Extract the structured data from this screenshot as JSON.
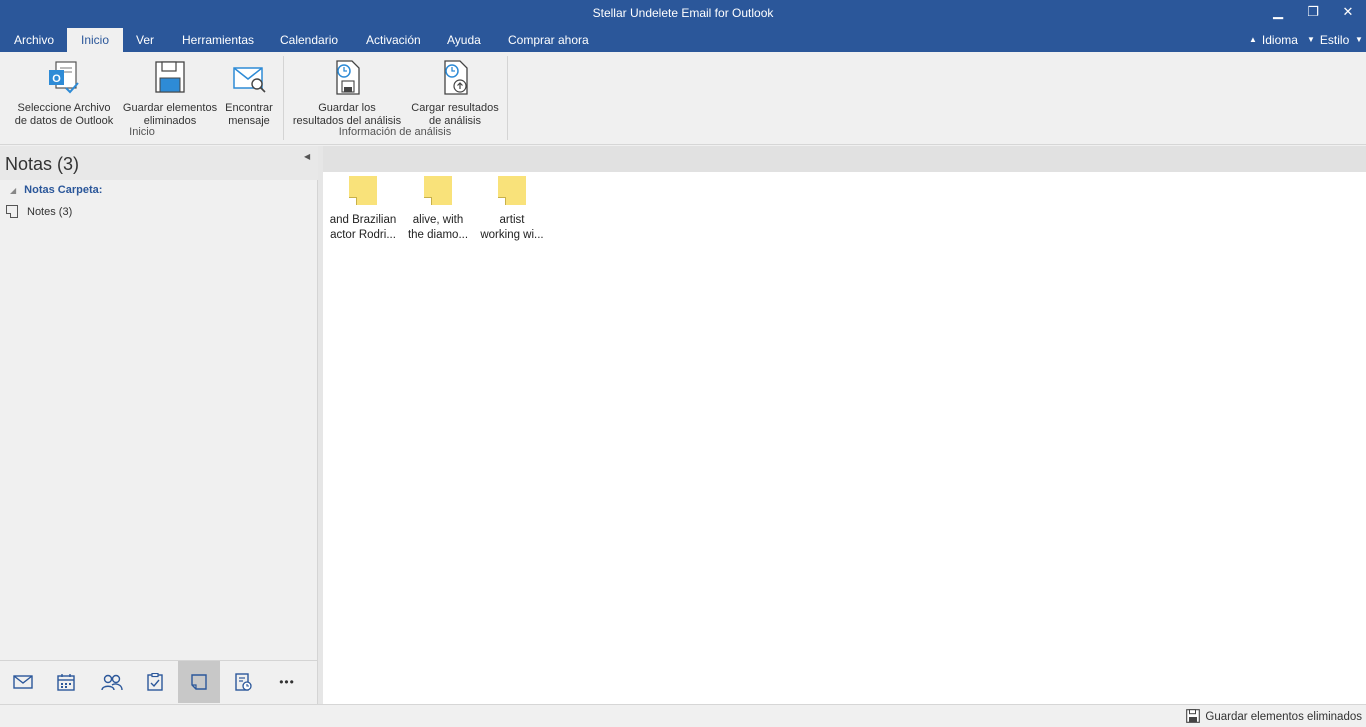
{
  "window": {
    "title": "Stellar Undelete Email for Outlook",
    "minimize": "▁",
    "restore": "❐",
    "close": "✕"
  },
  "menu": {
    "tabs": [
      {
        "label": "Archivo"
      },
      {
        "label": "Inicio",
        "active": true
      },
      {
        "label": "Ver"
      },
      {
        "label": "Herramientas"
      },
      {
        "label": "Calendario"
      },
      {
        "label": "Activación"
      },
      {
        "label": "Ayuda"
      },
      {
        "label": "Comprar ahora"
      }
    ],
    "language": "Idioma",
    "style": "Estilo"
  },
  "ribbon": {
    "groups": [
      {
        "label": "Inicio",
        "buttons": [
          {
            "line1": "Seleccione Archivo",
            "line2": "de datos de Outlook",
            "icon": "outlook-file-icon"
          },
          {
            "line1": "Guardar elementos",
            "line2": "eliminados",
            "icon": "save-icon"
          },
          {
            "line1": "Encontrar",
            "line2": "mensaje",
            "icon": "find-message-icon"
          }
        ]
      },
      {
        "label": "Información de análisis",
        "buttons": [
          {
            "line1": "Guardar los",
            "line2": "resultados del análisis",
            "icon": "save-scan-icon"
          },
          {
            "line1": "Cargar resultados",
            "line2": "de análisis",
            "icon": "load-scan-icon"
          }
        ]
      }
    ]
  },
  "left_panel": {
    "title": "Notas (3)",
    "folder_group": "Notas Carpeta:",
    "folder_item": "Notes (3)"
  },
  "bottom_nav": {
    "items": [
      "mail-icon",
      "calendar-icon",
      "contacts-icon",
      "tasks-icon",
      "notes-icon",
      "journal-icon",
      "more-icon"
    ],
    "active": "notes-icon",
    "more_label": "•••"
  },
  "notes": [
    {
      "line1": "and Brazilian",
      "line2": "actor Rodri..."
    },
    {
      "line1": "alive, with",
      "line2": "the diamo..."
    },
    {
      "line1": "artist",
      "line2": "working wi..."
    }
  ],
  "status": {
    "save_label": "Guardar elementos eliminados"
  },
  "colors": {
    "accent": "#2b579a",
    "note_yellow": "#f9e27a",
    "icon_blue": "#2e8bd6"
  }
}
